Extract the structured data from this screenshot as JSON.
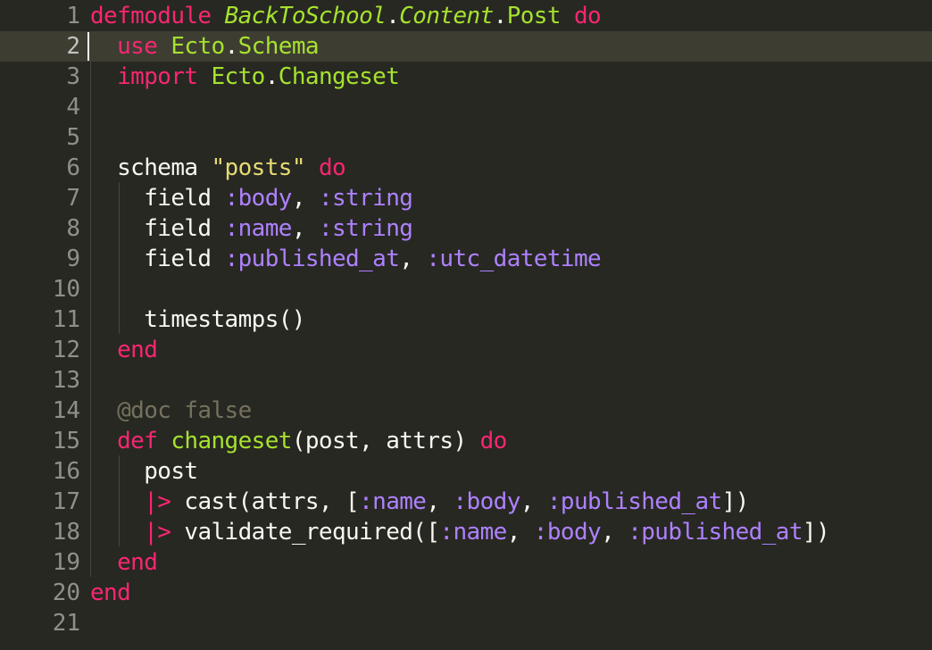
{
  "editor": {
    "language": "elixir",
    "theme_colors": {
      "background": "#272822",
      "active_line": "#3E3D32",
      "gutter_text": "#90908A",
      "keyword": "#F92672",
      "module": "#A6E22E",
      "string": "#E6DB74",
      "atom": "#AE81FF",
      "comment": "#75715E",
      "text": "#F8F8F2"
    },
    "active_line": 2,
    "line_numbers": [
      "1",
      "2",
      "3",
      "4",
      "5",
      "6",
      "7",
      "8",
      "9",
      "10",
      "11",
      "12",
      "13",
      "14",
      "15",
      "16",
      "17",
      "18",
      "19",
      "20",
      "21"
    ]
  },
  "tokens": {
    "l1": [
      "defmodule",
      " ",
      "BackToSchool",
      ".",
      "Content",
      ".",
      "Post",
      " ",
      "do"
    ],
    "l2": [
      "  ",
      "use",
      " ",
      "Ecto",
      ".",
      "Schema"
    ],
    "l3": [
      "  ",
      "import",
      " ",
      "Ecto",
      ".",
      "Changeset"
    ],
    "l6": [
      "  ",
      "schema",
      " ",
      "\"posts\"",
      " ",
      "do"
    ],
    "l7": [
      "    ",
      "field",
      " ",
      ":body",
      ", ",
      ":string"
    ],
    "l8": [
      "    ",
      "field",
      " ",
      ":name",
      ", ",
      ":string"
    ],
    "l9": [
      "    ",
      "field",
      " ",
      ":published_at",
      ", ",
      ":utc_datetime"
    ],
    "l11": [
      "    ",
      "timestamps()"
    ],
    "l12": [
      "  ",
      "end"
    ],
    "l14": [
      "  ",
      "@doc false"
    ],
    "l15": [
      "  ",
      "def",
      " ",
      "changeset",
      "(post, attrs)",
      " ",
      "do"
    ],
    "l16": [
      "    ",
      "post"
    ],
    "l17": [
      "    ",
      "|>",
      " ",
      "cast(attrs, [",
      ":name",
      ", ",
      ":body",
      ", ",
      ":published_at",
      "])"
    ],
    "l18": [
      "    ",
      "|>",
      " ",
      "validate_required([",
      ":name",
      ", ",
      ":body",
      ", ",
      ":published_at",
      "])"
    ],
    "l19": [
      "  ",
      "end"
    ],
    "l20": [
      "end"
    ]
  }
}
